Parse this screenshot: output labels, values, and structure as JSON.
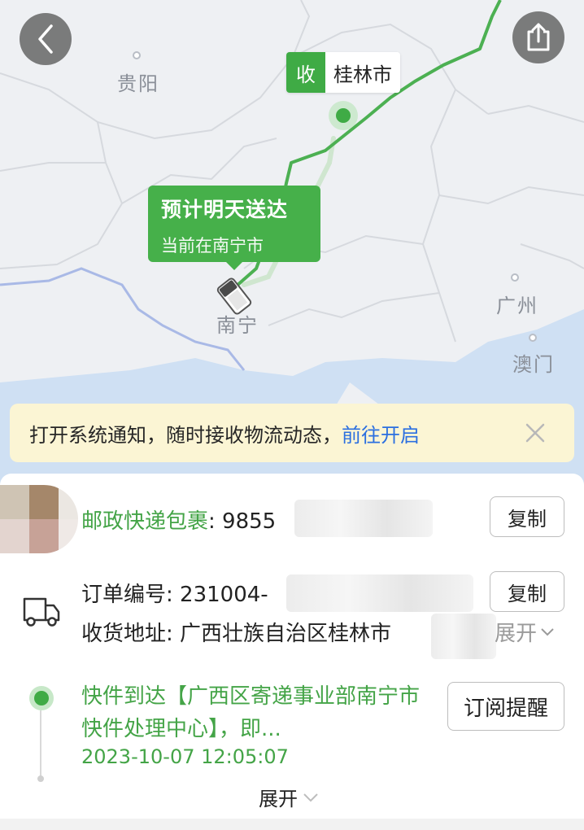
{
  "map": {
    "cities": [
      {
        "id": "guiyang",
        "name": "贵阳"
      },
      {
        "id": "nanning",
        "name": "南宁"
      },
      {
        "id": "guangzhou",
        "name": "广州"
      },
      {
        "id": "macau",
        "name": "澳门"
      }
    ],
    "destination_tag": {
      "key": "收",
      "value": "桂林市"
    },
    "eta": {
      "title": "预计明天送达",
      "subtitle": "当前在南宁市"
    },
    "colors": {
      "route": "#4cb052",
      "accent": "#3fab45",
      "water": "#cfe0f3"
    }
  },
  "toolbar": {
    "back_icon": "chevron-left-icon",
    "share_icon": "share-icon"
  },
  "notice": {
    "text": "打开系统通知，随时接收物流动态，",
    "link": "前往开启",
    "close_icon": "close-icon"
  },
  "package": {
    "carrier_label": "邮政快递包裹",
    "tracking_prefix": ": 9855",
    "copy_label": "复制"
  },
  "order": {
    "order_label": "订单编号: 231004-",
    "copy_label": "复制",
    "address_label": "收货地址: 广西壮族自治区桂林市",
    "expand_label": "展开"
  },
  "event": {
    "text": "快件到达【广西区寄递事业部南宁市快件处理中心】，即...",
    "time": "2023-10-07 12:05:07",
    "subscribe_label": "订阅提醒"
  },
  "footer": {
    "expand_label": "展开"
  }
}
